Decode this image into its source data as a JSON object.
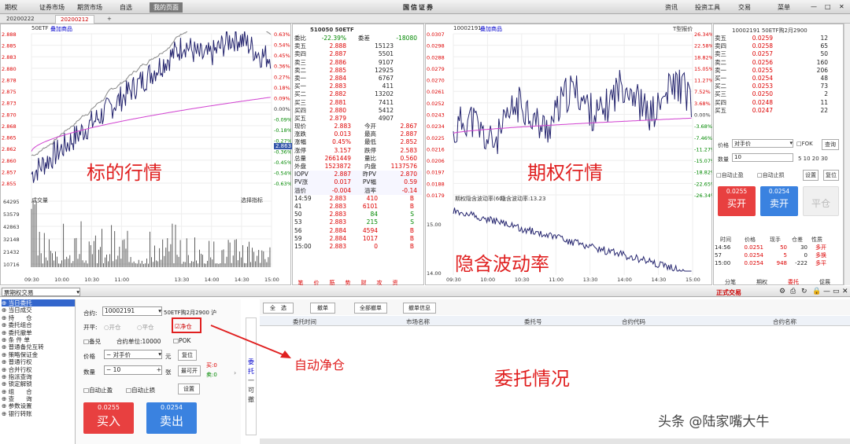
{
  "menu": [
    "期权",
    "证券市场",
    "期货市场",
    "自选",
    "我的页面"
  ],
  "app_title": "国信证券",
  "menu_right": [
    "资讯",
    "投资工具",
    "交易",
    "菜单"
  ],
  "tabs": [
    "20200222",
    "20200212"
  ],
  "underlying": {
    "header": "50ETF",
    "overlay": "叠加商品",
    "main_y": [
      "2.888",
      "2.885",
      "2.883",
      "2.880",
      "2.878",
      "2.875",
      "2.873",
      "2.870",
      "2.868",
      "2.865",
      "2.862",
      "2.860",
      "2.857",
      "2.855"
    ],
    "pct": [
      "0.63%",
      "0.54%",
      "0.45%",
      "0.36%",
      "0.27%",
      "0.18%",
      "0.09%",
      "0.00%",
      "-0.09%",
      "-0.18%",
      "-0.27%",
      "-0.36%",
      "-0.45%",
      "-0.54%",
      "-0.63%"
    ],
    "last_tag": "2.863",
    "vol_label": "成交量",
    "indicator": "选择指标",
    "vol_y": [
      "64295",
      "53579",
      "42863",
      "32148",
      "21432",
      "10716"
    ],
    "x": [
      "09:30",
      "10:00",
      "10:30",
      "11:00",
      "11:20",
      "13:30",
      "14:00",
      "14:30",
      "15:00"
    ],
    "big": "标的行情"
  },
  "quote": {
    "code": "510050 50ETF",
    "wb": "委比",
    "wb_v": "-22.39%",
    "wc": "委差",
    "wc_v": "-18080",
    "asks": [
      [
        "卖五",
        "2.888",
        "15123"
      ],
      [
        "卖四",
        "2.887",
        "5501"
      ],
      [
        "卖三",
        "2.886",
        "9107"
      ],
      [
        "卖二",
        "2.885",
        "12925"
      ],
      [
        "卖一",
        "2.884",
        "6767"
      ]
    ],
    "bids": [
      [
        "买一",
        "2.883",
        "411"
      ],
      [
        "买二",
        "2.882",
        "13202"
      ],
      [
        "买三",
        "2.881",
        "7411"
      ],
      [
        "买四",
        "2.880",
        "5412"
      ],
      [
        "买五",
        "2.879",
        "4907"
      ]
    ],
    "stats": [
      [
        "现价",
        "2.883",
        "今开",
        "2.867"
      ],
      [
        "涨跌",
        "0.013",
        "最高",
        "2.887"
      ],
      [
        "涨幅",
        "0.45%",
        "最低",
        "2.852"
      ],
      [
        "涨停",
        "3.157",
        "跌停",
        "2.583"
      ],
      [
        "总量",
        "2661449",
        "量比",
        "0.560"
      ],
      [
        "外盘",
        "1523872",
        "内盘",
        "1137576"
      ]
    ],
    "iopv": [
      [
        "IOPV",
        "2.887",
        "昨PV",
        "2.870"
      ],
      [
        "PV涨",
        "0.017",
        "PV幅",
        "0.59"
      ],
      [
        "溢价",
        "-0.004",
        "溢率",
        "-0.14"
      ]
    ],
    "ticks": [
      [
        "14:59",
        "2.883",
        "410",
        "B"
      ],
      [
        "41",
        "2.883",
        "6101",
        "B"
      ],
      [
        "50",
        "2.883",
        "84",
        "S"
      ],
      [
        "53",
        "2.883",
        "215",
        "S"
      ],
      [
        "56",
        "2.884",
        "4594",
        "B"
      ],
      [
        "59",
        "2.884",
        "1017",
        "B"
      ],
      [
        "15:00",
        "2.883",
        "0",
        "B"
      ]
    ],
    "bottom_tabs": [
      "笔",
      "价",
      "筋",
      "势",
      "财",
      "攻",
      "资"
    ]
  },
  "option": {
    "header": "10002191",
    "overlay": "叠加商品",
    "y": [
      "0.0307",
      "0.0298",
      "0.0288",
      "0.0279",
      "0.0270",
      "0.0261",
      "0.0252",
      "0.0243",
      "0.0234",
      "0.0225",
      "0.0216",
      "0.0206",
      "0.0197",
      "0.0188",
      "0.0179"
    ],
    "pct": [
      "26.34%",
      "22.58%",
      "18.82%",
      "15.05%",
      "11.27%",
      "7.52%",
      "3.68%",
      "0.00%",
      "-3.68%",
      "-7.46%",
      "-11.27%",
      "-15.07%",
      "-18.82%",
      "-22.65%",
      "-26.34%"
    ],
    "t": "T型报价",
    "big": "期权行情",
    "iv_label": "期权隐含波动率(60)",
    "iv_value": "隐含波动率:13.23",
    "iv_y": [
      "15.00",
      "14.00"
    ],
    "iv_big": "隐含波动率",
    "x": [
      "09:30",
      "10:00",
      "10:30",
      "11:00",
      "13:30",
      "14:00",
      "14:30",
      "15:00"
    ]
  },
  "oquote": {
    "title": "10002191 50ETF购2月2900",
    "asks": [
      [
        "卖五",
        "0.0259",
        "12"
      ],
      [
        "卖四",
        "0.0258",
        "65"
      ],
      [
        "卖三",
        "0.0257",
        "50"
      ],
      [
        "卖二",
        "0.0256",
        "160"
      ],
      [
        "卖一",
        "0.0255",
        "206"
      ]
    ],
    "bids": [
      [
        "买一",
        "0.0254",
        "48"
      ],
      [
        "买二",
        "0.0253",
        "73"
      ],
      [
        "买三",
        "0.0250",
        "2"
      ],
      [
        "买四",
        "0.0248",
        "11"
      ],
      [
        "买五",
        "0.0247",
        "22"
      ]
    ],
    "price_lbl": "价格",
    "price_val": "对手价",
    "fok": "FOK",
    "query": "查询",
    "qty_lbl": "数量",
    "qty_val": "10",
    "qty_opts": "5 10 20 30",
    "auto_profit": "自动止盈",
    "auto_loss": "自动止损",
    "settings": "设置",
    "reset": "复位",
    "buy_price": "0.0255",
    "buy": "买开",
    "sell_price": "0.0254",
    "sell": "卖开",
    "close": "平仓",
    "tick_head": [
      "时间",
      "价格",
      "现手",
      "仓差",
      "性质"
    ],
    "ticks": [
      [
        "14:56",
        "0.0251",
        "50",
        "30",
        "多开"
      ],
      [
        "57",
        "0.0254",
        "5",
        "0",
        "多换"
      ],
      [
        "15:00",
        "0.0254",
        "948",
        "-222",
        "多平"
      ]
    ],
    "btabs": [
      "分笔",
      "期权",
      "委托",
      "促展"
    ]
  },
  "trade": {
    "dropdown": "票期权交易",
    "formal": "正式交易",
    "nav": [
      "当日委托",
      "当日成交",
      "持　　仓",
      "委托组合",
      "委托撤单",
      "条 件 单",
      "普通备兑互转",
      "策略保证金",
      "普通行权",
      "合并行权",
      "指派查询",
      "锁定解锁",
      "组　　合",
      "查　　询",
      "参数设置",
      "银行转账"
    ],
    "contract_lbl": "合约:",
    "contract_val": "10002191",
    "contract_name": "50ETF购2月2900 沪",
    "kaiping": "开平:",
    "kai": "开仓",
    "ping": "平仓",
    "jingcang": "净仓",
    "beidui": "备兑",
    "unit": "合约单位:10000",
    "pok": "POK",
    "price_lbl": "价格",
    "price_val": "对手价",
    "yuan": "元",
    "reset": "复位",
    "qty_lbl": "数量",
    "qty_val": "10",
    "zhang": "张",
    "kekai": "最可开",
    "mai": "买:0",
    "mai2": "卖:0",
    "auto_profit": "自动止盈",
    "auto_loss": "自动止损",
    "settings": "设置",
    "buy_price": "0.0255",
    "buy": "买入",
    "sell_price": "0.0254",
    "sell": "卖出",
    "side": [
      "委",
      "托",
      "一",
      "可",
      "撤"
    ],
    "actions": [
      "全　选",
      "撤单",
      "全部撤单",
      "撤单信息"
    ],
    "cols": [
      "委托时间",
      "市场名称",
      "委托号",
      "合约代码",
      "合约名称"
    ],
    "arrow_label": "自动净仓",
    "center_big": "委托情况",
    "watermark": "头条 @陆家嘴大牛"
  }
}
